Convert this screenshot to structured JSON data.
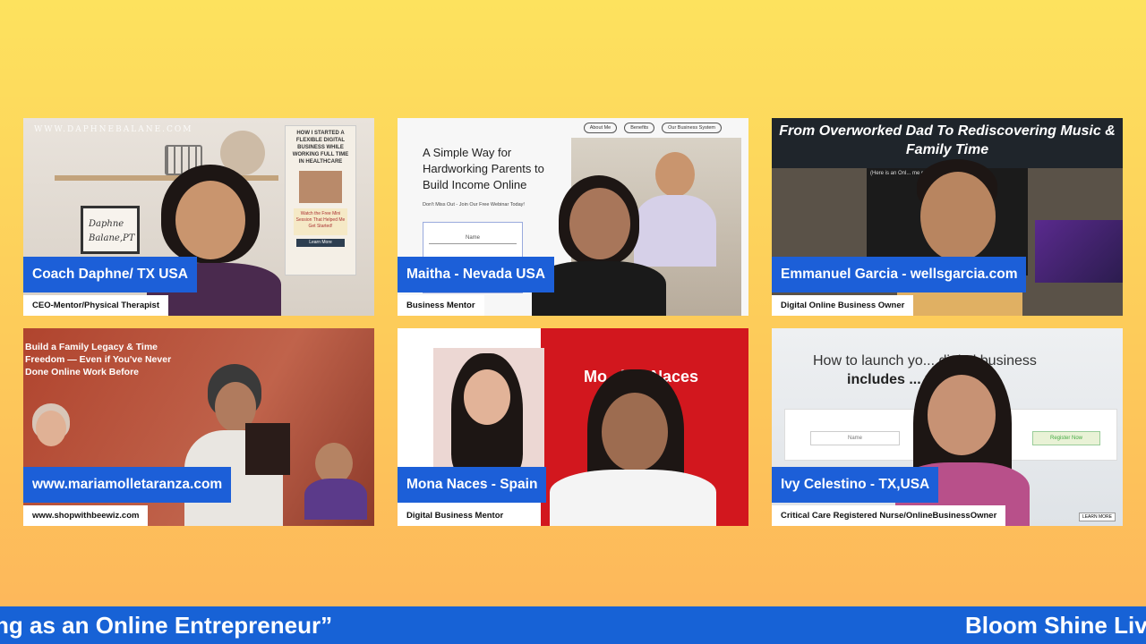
{
  "tiles": [
    {
      "name": "Coach Daphne/ TX USA",
      "role": "CEO-Mentor/Physical Therapist",
      "scene": {
        "watermark": "WWW.DAPHNEBALANE.COM",
        "frame_text": "Daphne\nBalane,PT",
        "poster_title": "HOW I STARTED A FLEXIBLE DIGITAL BUSINESS WHILE WORKING FULL TIME IN HEALTHCARE",
        "poster_cta": "Watch the Free Mini Session That Helped Me Get Started!",
        "poster_button": "Learn More"
      }
    },
    {
      "name": "Maitha - Nevada USA",
      "role": "Business Mentor",
      "scene": {
        "nav": [
          "About Me",
          "Benefits",
          "Our Business System"
        ],
        "headline": "A Simple Way for Hardworking Parents to Build Income Online",
        "subline": "Don't Miss Out - Join Our Free Webinar Today!",
        "field": "Name"
      }
    },
    {
      "name": "Emmanuel Garcia - wellsgarcia.com",
      "role": "Digital Online Business Owner",
      "scene": {
        "banner": "From Overworked Dad To Rediscovering Music & Family Time",
        "inner_caption": "(Here is an Onl... me reconnect"
      }
    },
    {
      "name": "www.mariamolletaranza.com",
      "role": "www.shopwithbeewiz.com",
      "scene": {
        "headline": "Build a Family Legacy & Time Freedom — Even if You've Never Done Online Work Before"
      }
    },
    {
      "name": "Mona Naces - Spain",
      "role": "Digital Business Mentor",
      "scene": {
        "title": "Mo...liza Naces"
      }
    },
    {
      "name": "Ivy Celestino - TX,USA",
      "role": "Critical Care Registered Nurse/OnlineBusinessOwner",
      "scene": {
        "title_line1": "How to launch yo... digital business",
        "title_line2": "includes ... you need",
        "field": "Name",
        "button": "Register Now",
        "small_button": "LEARN MORE"
      }
    }
  ],
  "ticker": {
    "left_text": "ng as an Online Entrepreneur”",
    "right_text": "Bloom Shine Liv"
  },
  "colors": {
    "background_top": "#fde25e",
    "background_bottom": "#fdb55b",
    "name_tag": "#1c5fd8",
    "ticker": "#1762d6"
  }
}
